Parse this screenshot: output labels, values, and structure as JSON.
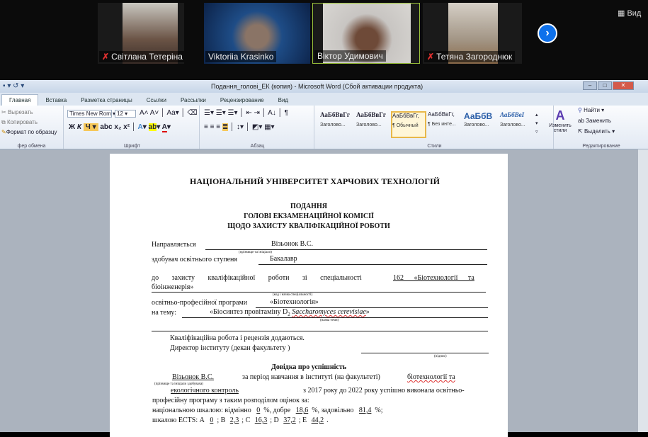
{
  "meeting": {
    "participants": [
      {
        "name": "Світлана Тетеріна",
        "muted": true
      },
      {
        "name": "Viktoriia Krasinko",
        "muted": false
      },
      {
        "name": "Віктор Удимович",
        "muted": false,
        "active": true
      },
      {
        "name": "Тетяна Загороднюк",
        "muted": true
      }
    ],
    "view_label": "Вид",
    "next_icon": "chevron-right-icon"
  },
  "word": {
    "title": "Подання_голові_ЕК (копия) - Microsoft Word (Сбой активации продукта)",
    "tabs": [
      "Главная",
      "Вставка",
      "Разметка страницы",
      "Ссылки",
      "Рассылки",
      "Рецензирование",
      "Вид"
    ],
    "clipboard": {
      "cut": "Вырезать",
      "copy": "Копировать",
      "format": "Формат по образцу",
      "label": "фер обмена"
    },
    "font": {
      "name": "Times New Rom",
      "size": "12",
      "label": "Шрифт"
    },
    "paragraph_label": "Абзац",
    "styles": [
      {
        "sample": "АаБбВвГг",
        "name": "Заголово..."
      },
      {
        "sample": "АаБбВвГг",
        "name": "Заголово..."
      },
      {
        "sample": "АаБбВвГг,",
        "name": "¶ Обычный"
      },
      {
        "sample": "АаБбВвГг,",
        "name": "¶ Без инте..."
      },
      {
        "sample": "АаБбВ",
        "name": "Заголово..."
      },
      {
        "sample": "АаБбВвІ",
        "name": "Заголово..."
      }
    ],
    "styles_label": "Стили",
    "change_styles": "Изменить стили",
    "editing": {
      "find": "Найти",
      "replace": "Заменить",
      "select": "Выделить",
      "label": "Редактирование"
    }
  },
  "document": {
    "university": "НАЦІОНАЛЬНИЙ УНІВЕРСИТЕТ ХАРЧОВИХ ТЕХНОЛОГІЙ",
    "heading1": "ПОДАННЯ",
    "heading2": "ГОЛОВІ ЕКЗАМЕНАЦІЙНОЇ КОМІСІЇ",
    "heading3": "ЩОДО ЗАХИСТУ КВАЛІФІКАЦІЙНОЇ РОБОТИ",
    "directed_label": "Направляється",
    "student": "Візьонок В.С.",
    "hint_name": "(прізвище та ініціали)",
    "degree_label": "здобувач освітнього ступеня",
    "degree": "Бакалавр",
    "defense_text": "до захисту кваліфікаційної роботи зі спеціальності",
    "specialty": "162 «Біотехнології та біоінженерія»",
    "specialty_line1": "162 «Біотехнології та",
    "specialty_line2": "біоінженерія»",
    "hint_specialty": "(код і назва спеціальності)",
    "program_label": "освітньо-професійної програми",
    "program": "«Біотехнологія»",
    "topic_label": "на тему:",
    "topic_a": "«Біосинтез провітаміну D",
    "topic_sub": "2",
    "topic_b": "Saccharomyces cerevisiae",
    "topic_c": "»",
    "hint_topic": "(назва теми)",
    "attached": "Кваліфікаційна робота і рецензія додаються.",
    "director": "Директор інституту  (декан факультету )",
    "hint_signature": "(підпис)",
    "reference_title": "Довідка про успішність",
    "ref_line1": "за період навчання в інституті (на факультеті)",
    "faculty1": "біотехнології та",
    "hint_student": "(прізвище та ініціали здобувача)",
    "faculty2": "екологічного контроль",
    "ref_line2": "з 2017 року до 2022 року успішно виконала освітньо-",
    "ref_line3": "професійну програму з таким розподілом оцінок за:",
    "national_label": "національною шкалою: відмінно",
    "excellent": "0",
    "good_label": "%, добре",
    "good": "18,6",
    "satisf_label": "%, задовільно",
    "satisf": "81,4",
    "pct": "%;",
    "ects_label": "шкалою ECTS: А",
    "ects": {
      "A": "0",
      "B": "2,3",
      "C": "16,3",
      "D": "37,2",
      "E": "44,2"
    }
  }
}
